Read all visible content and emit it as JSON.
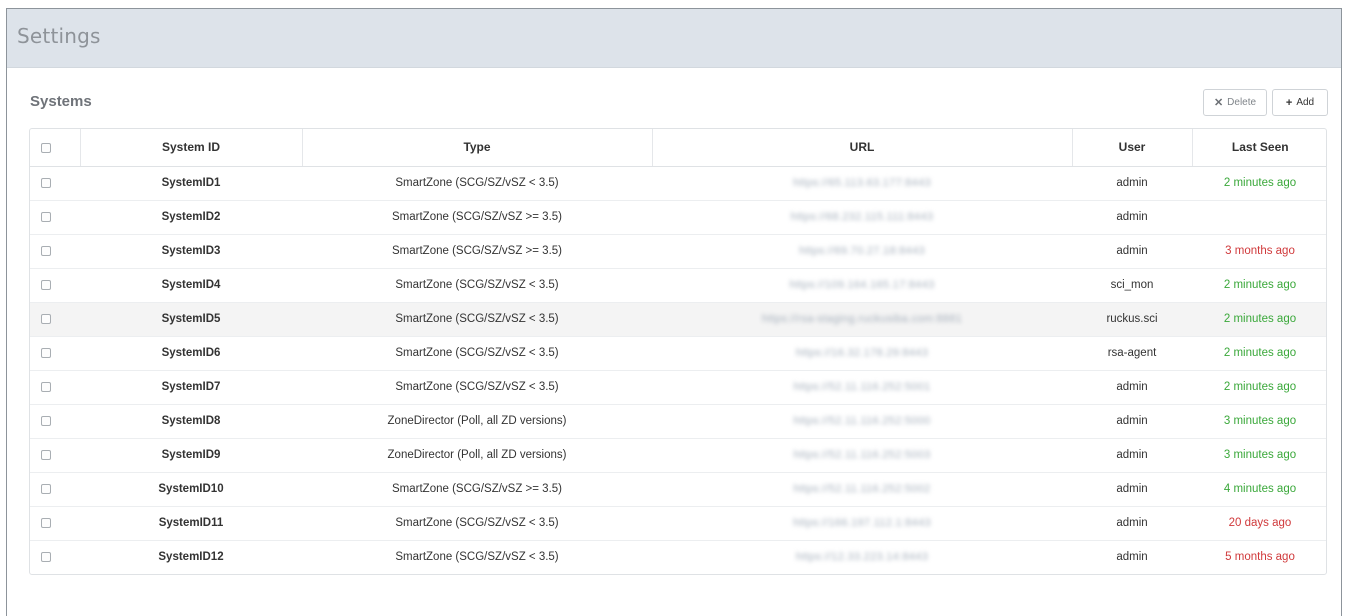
{
  "header": {
    "title": "Settings"
  },
  "systems": {
    "title": "Systems",
    "delete_label": "Delete",
    "add_label": "Add"
  },
  "colors": {
    "recent": "#3aa83a",
    "stale": "#d0393b",
    "header_bg": "#dde3ea"
  },
  "table": {
    "columns": [
      "System ID",
      "Type",
      "URL",
      "User",
      "Last Seen"
    ],
    "rows": [
      {
        "id": "SystemID1",
        "type": "SmartZone (SCG/SZ/vSZ < 3.5)",
        "url": "https://65.113.63.177:8443",
        "user": "admin",
        "last_seen": "2 minutes ago",
        "status": "recent"
      },
      {
        "id": "SystemID2",
        "type": "SmartZone (SCG/SZ/vSZ >= 3.5)",
        "url": "https://68.232.115.111:8443",
        "user": "admin",
        "last_seen": "",
        "status": "none"
      },
      {
        "id": "SystemID3",
        "type": "SmartZone (SCG/SZ/vSZ >= 3.5)",
        "url": "https://69.70.27.18:8443",
        "user": "admin",
        "last_seen": "3 months ago",
        "status": "stale"
      },
      {
        "id": "SystemID4",
        "type": "SmartZone (SCG/SZ/vSZ < 3.5)",
        "url": "https://109.164.165.17:8443",
        "user": "sci_mon",
        "last_seen": "2 minutes ago",
        "status": "recent"
      },
      {
        "id": "SystemID5",
        "type": "SmartZone (SCG/SZ/vSZ < 3.5)",
        "url": "https://rsa-staging.ruckusiba.com:8881",
        "user": "ruckus.sci",
        "last_seen": "2 minutes ago",
        "status": "recent"
      },
      {
        "id": "SystemID6",
        "type": "SmartZone (SCG/SZ/vSZ < 3.5)",
        "url": "https://16.32.178.29:8443",
        "user": "rsa-agent",
        "last_seen": "2 minutes ago",
        "status": "recent"
      },
      {
        "id": "SystemID7",
        "type": "SmartZone (SCG/SZ/vSZ < 3.5)",
        "url": "https://52.11.116.252:5001",
        "user": "admin",
        "last_seen": "2 minutes ago",
        "status": "recent"
      },
      {
        "id": "SystemID8",
        "type": "ZoneDirector (Poll, all ZD versions)",
        "url": "https://52.11.116.252:5000",
        "user": "admin",
        "last_seen": "3 minutes ago",
        "status": "recent"
      },
      {
        "id": "SystemID9",
        "type": "ZoneDirector (Poll, all ZD versions)",
        "url": "https://52.11.116.252:5003",
        "user": "admin",
        "last_seen": "3 minutes ago",
        "status": "recent"
      },
      {
        "id": "SystemID10",
        "type": "SmartZone (SCG/SZ/vSZ >= 3.5)",
        "url": "https://52.11.116.252:5002",
        "user": "admin",
        "last_seen": "4 minutes ago",
        "status": "recent"
      },
      {
        "id": "SystemID11",
        "type": "SmartZone (SCG/SZ/vSZ < 3.5)",
        "url": "https://166.197.112.1:8443",
        "user": "admin",
        "last_seen": "20 days ago",
        "status": "stale"
      },
      {
        "id": "SystemID12",
        "type": "SmartZone (SCG/SZ/vSZ < 3.5)",
        "url": "https://12.33.223.14:8443",
        "user": "admin",
        "last_seen": "5 months ago",
        "status": "stale"
      }
    ]
  }
}
